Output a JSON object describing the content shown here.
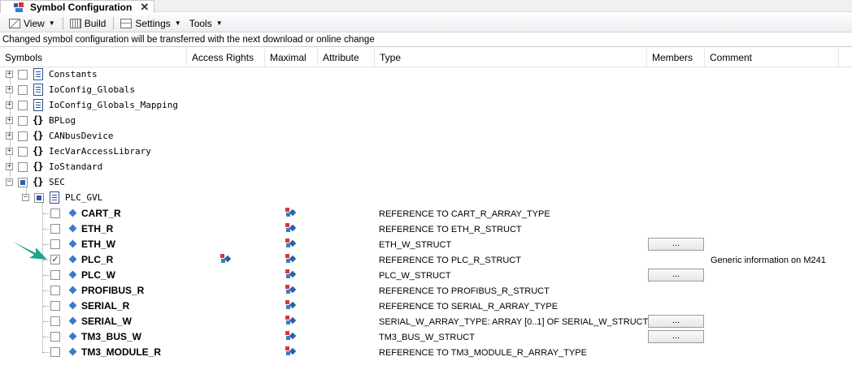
{
  "tab": {
    "title": "Symbol Configuration",
    "close_glyph": "✕"
  },
  "toolbar": {
    "view_label": "View",
    "build_label": "Build",
    "settings_label": "Settings",
    "tools_label": "Tools"
  },
  "info_message": "Changed symbol configuration will be transferred with the next download or online change",
  "columns": {
    "symbols": "Symbols",
    "access_rights": "Access Rights",
    "maximal": "Maximal",
    "attribute": "Attribute",
    "type": "Type",
    "members": "Members",
    "comment": "Comment"
  },
  "tree": {
    "constants": "Constants",
    "ioconfig_globals": "IoConfig_Globals",
    "ioconfig_globals_mapping": "IoConfig_Globals_Mapping",
    "bplog": "BPLog",
    "canbusdevice": "CANbusDevice",
    "iecvaraccesslibrary": "IecVarAccessLibrary",
    "iostandard": "IoStandard",
    "sec": "SEC",
    "plc_gvl": "PLC_GVL"
  },
  "variables": [
    {
      "name": "CART_R",
      "type": "REFERENCE TO CART_R_ARRAY_TYPE",
      "members": "",
      "comment": "",
      "checked": false
    },
    {
      "name": "ETH_R",
      "type": "REFERENCE TO ETH_R_STRUCT",
      "members": "",
      "comment": "",
      "checked": false
    },
    {
      "name": "ETH_W",
      "type": "ETH_W_STRUCT",
      "members": "...",
      "comment": "",
      "checked": false
    },
    {
      "name": "PLC_R",
      "type": "REFERENCE TO PLC_R_STRUCT",
      "members": "",
      "comment": "Generic information on M241",
      "checked": true
    },
    {
      "name": "PLC_W",
      "type": "PLC_W_STRUCT",
      "members": "...",
      "comment": "",
      "checked": false
    },
    {
      "name": "PROFIBUS_R",
      "type": "REFERENCE TO PROFIBUS_R_STRUCT",
      "members": "",
      "comment": "",
      "checked": false
    },
    {
      "name": "SERIAL_R",
      "type": "REFERENCE TO SERIAL_R_ARRAY_TYPE",
      "members": "",
      "comment": "",
      "checked": false
    },
    {
      "name": "SERIAL_W",
      "type": "SERIAL_W_ARRAY_TYPE: ARRAY [0..1] OF SERIAL_W_STRUCT",
      "members": "...",
      "comment": "",
      "checked": false
    },
    {
      "name": "TM3_BUS_W",
      "type": "TM3_BUS_W_STRUCT",
      "members": "...",
      "comment": "",
      "checked": false
    },
    {
      "name": "TM3_MODULE_R",
      "type": "REFERENCE TO TM3_MODULE_R_ARRAY_TYPE",
      "members": "",
      "comment": "",
      "checked": false
    }
  ],
  "checkmark_glyph": "✓",
  "colors": {
    "accent_arrow": "#1fa38a",
    "var_icon": "#3b7bc8",
    "partial_check": "#2d5fa8"
  }
}
